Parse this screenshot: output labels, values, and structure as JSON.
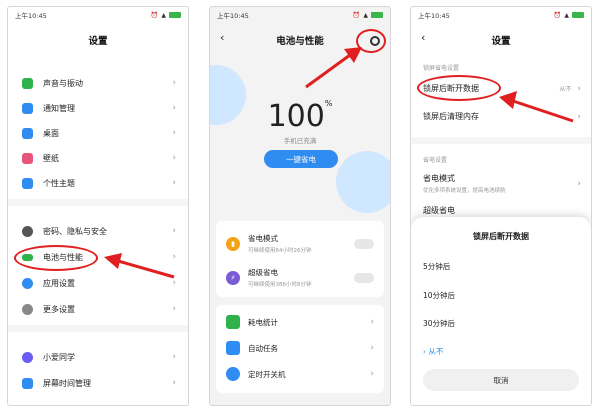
{
  "status_time": "上午10:45",
  "screen1": {
    "title": "设置",
    "items": [
      {
        "label": "声音与振动",
        "icon": "speaker-icon",
        "color": "#2fb24a"
      },
      {
        "label": "通知管理",
        "icon": "bell-icon",
        "color": "#2f8cf0"
      },
      {
        "label": "桌面",
        "icon": "home-icon",
        "color": "#2f8cf0"
      },
      {
        "label": "壁纸",
        "icon": "flower-icon",
        "color": "#e8557a"
      },
      {
        "label": "个性主题",
        "icon": "brush-icon",
        "color": "#2f8cf0"
      },
      {
        "label": "密码、隐私与安全",
        "icon": "fingerprint-icon",
        "color": "#555555"
      },
      {
        "label": "电池与性能",
        "icon": "battery-icon",
        "color": "#2fb24a"
      },
      {
        "label": "应用设置",
        "icon": "gear-icon",
        "color": "#2f8cf0"
      },
      {
        "label": "更多设置",
        "icon": "dots-icon",
        "color": "#888888"
      },
      {
        "label": "小爱同学",
        "icon": "assistant-icon",
        "color": "#6a5cf0"
      },
      {
        "label": "屏幕时间管理",
        "icon": "hourglass-icon",
        "color": "#2f8cf0"
      }
    ]
  },
  "screen2": {
    "title": "电池与性能",
    "percent": "100",
    "percent_unit": "%",
    "charge_status": "手机已充满",
    "one_key_button": "一键省电",
    "modes": [
      {
        "label": "省电模式",
        "sub": "可继续使用64小时26分钟",
        "icon": "battery-saver-icon",
        "color": "#f3a316"
      },
      {
        "label": "超级省电",
        "sub": "可继续使用386小时8分钟",
        "icon": "bolt-icon",
        "color": "#7b5cd6"
      }
    ],
    "links": [
      {
        "label": "耗电统计",
        "icon": "chart-icon",
        "color": "#2fb24a"
      },
      {
        "label": "自动任务",
        "icon": "task-icon",
        "color": "#2f8cf0"
      },
      {
        "label": "定时开关机",
        "icon": "clock-icon",
        "color": "#2f8cf0"
      }
    ]
  },
  "screen3": {
    "title": "设置",
    "section_lock": "锁屏省电设置",
    "row1_label": "锁屏后断开数据",
    "row1_value": "从不",
    "row2_label": "锁屏后清理内存",
    "section_save": "省电设置",
    "row3_label": "省电模式",
    "row3_sub": "优化多项系统设置，提高电池续航",
    "row4_label": "超级省电",
    "sheet_title": "锁屏后断开数据",
    "options": [
      "5分钟后",
      "10分钟后",
      "30分钟后",
      "从不"
    ],
    "selected_index": 3,
    "cancel_label": "取消"
  },
  "highlight_color": "#e02020"
}
